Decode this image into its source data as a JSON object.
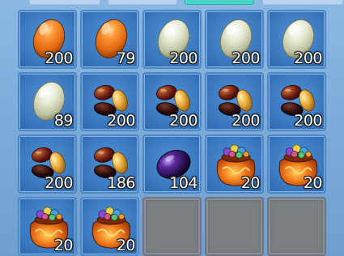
{
  "inventory": {
    "slots": [
      {
        "item": "orange-egg",
        "count": "200"
      },
      {
        "item": "orange-egg",
        "count": "79"
      },
      {
        "item": "pale-egg",
        "count": "200"
      },
      {
        "item": "pale-egg",
        "count": "200"
      },
      {
        "item": "pale-egg",
        "count": "200"
      },
      {
        "item": "pale-egg",
        "count": "89"
      },
      {
        "item": "jelly-beans",
        "count": "200"
      },
      {
        "item": "jelly-beans",
        "count": "200"
      },
      {
        "item": "jelly-beans",
        "count": "200"
      },
      {
        "item": "jelly-beans",
        "count": "200"
      },
      {
        "item": "jelly-beans",
        "count": "200"
      },
      {
        "item": "jelly-beans",
        "count": "186"
      },
      {
        "item": "purple-gem-egg",
        "count": "104"
      },
      {
        "item": "treasure-sack",
        "count": "20"
      },
      {
        "item": "treasure-sack",
        "count": "20"
      },
      {
        "item": "treasure-sack",
        "count": "20"
      },
      {
        "item": "treasure-sack",
        "count": "20"
      },
      {
        "item": "empty",
        "count": ""
      },
      {
        "item": "empty",
        "count": ""
      },
      {
        "item": "empty",
        "count": ""
      }
    ]
  },
  "colors": {
    "panel_bg": "#7faedb",
    "slot_bg": "#3a78bf",
    "slot_border": "#4f86c4",
    "empty_slot": "#7a7f84",
    "active_tab": "#48d6c8"
  }
}
